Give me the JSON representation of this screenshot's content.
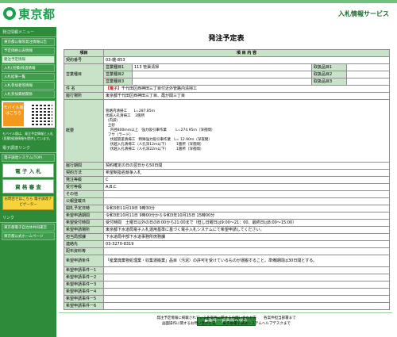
{
  "header": {
    "logo_text": "東京都",
    "service_title": "入札情報サービス"
  },
  "sidebar": {
    "menu_heading": "発注情報メニュー",
    "links": [
      "東京都公報等発注情報公告",
      "予定価格公表情報",
      "発注予定情報",
      "入札(見積)経過情報",
      "入札結果一覧",
      "入札参加者等情報",
      "入札参加資格関係"
    ],
    "mobile_button": "モバイル版はこちら",
    "mobile_note": "モバイル版は、発注予定情報と入札(見積)経過情報を提供しています。",
    "links_heading": "電子調達リンク",
    "system_link": "電子調達システム(TOP)",
    "big_buttons": [
      "電 子 入 札",
      "資 格 審 査"
    ],
    "ad_text": "お問合せはこちら 電子調達ナビゲーター",
    "other_heading": "リンク",
    "other_links": [
      "東京都電子自治体共同運営",
      "東京都公式ホームページ"
    ]
  },
  "main": {
    "title": "発注予定表",
    "header_row": {
      "left": "項目",
      "right": "項 目 内 容"
    },
    "rows": [
      {
        "label": "契約番号",
        "value": "03-雑-853"
      },
      {
        "label": "件 名",
        "tag": "【電子】",
        "value": "千代田区西神田三丁目付近外管路内清掃工"
      },
      {
        "label": "履行場所",
        "value": "東京都千代田区西神田三丁目、霞が関三丁目"
      }
    ],
    "business_type": {
      "label": "営業種目",
      "items": [
        {
          "name": "営業種目1",
          "value": "113 管渠清掃",
          "rank_label": "取扱品目1",
          "rank_value": ""
        },
        {
          "name": "営業種目2",
          "value": "",
          "rank_label": "取扱品目2",
          "rank_value": ""
        },
        {
          "name": "営業種目3",
          "value": "",
          "rank_label": "取扱品目3",
          "rank_value": ""
        }
      ]
    },
    "overview": {
      "label": "概要",
      "lines": [
        "管路内清掃工      L=287.85ｍ",
        "伏越入孔清掃工    2箇所",
        "（内訳）",
        "  土砂",
        "    内径800mm以上   強力吸引車作業        L=274.95ｍ（深夜間）",
        "  フサ（ラード）",
        "    伏越管渠清掃工   特殊強力吸引車作業   L= 12.90ｍ（深夜間）",
        "    伏越入孔清掃工（人孔深12ｍ以下）       1箇所（深夜間）",
        "    伏越入孔清掃工（人孔深22ｍ以下）       1箇所（深夜間）"
      ]
    },
    "rows2": [
      {
        "label": "履行期間",
        "value": "契約確定の日の翌日から50日間"
      },
      {
        "label": "契約方法",
        "value": "希望制指名競争入札"
      },
      {
        "label": "発注等級",
        "value": "C"
      },
      {
        "label": "受付等級",
        "value": "A,B,C"
      },
      {
        "label": "その他",
        "value": ""
      },
      {
        "label": "公報登載日",
        "value": ""
      },
      {
        "label": "開札予定日時",
        "value": "令和3年11月19日 9時30分"
      },
      {
        "label": "希望申請期間",
        "value": "令和3年10月11日 9時00分から令和3年10月15日 15時00分"
      },
      {
        "label": "希望受付時間",
        "value": "受付時間　土曜日以外の日の8:00から21:00まで（但し日曜日は9:00～21：00、最終日は8:00～15:00）"
      },
      {
        "label": "希望申請場所",
        "value": "東京都下水道局電子入札運用基準に基づく電子入札システムにて希望申請してください。"
      },
      {
        "label": "担当局部課",
        "value": "下水道局中部下水道事務所庶務課"
      },
      {
        "label": "連絡先",
        "value": "03-3270-8319"
      },
      {
        "label": "配布資料等",
        "value": ""
      },
      {
        "label": "希望申請条件",
        "value": "「産業廃棄物処理業・収集運搬業」品目（汚泥）の許可を受けているものが運搬すること。準備期間は30日間とする。"
      },
      {
        "label": "希望申請事件ー1",
        "value": ""
      },
      {
        "label": "希望申請事件ー2",
        "value": ""
      },
      {
        "label": "希望申請事件ー3",
        "value": ""
      },
      {
        "label": "希望申請事件ー4",
        "value": ""
      },
      {
        "label": "希望申請事件ー5",
        "value": ""
      },
      {
        "label": "希望申請事件ー6",
        "value": ""
      }
    ],
    "list_button": "▶案件一覧画面へ戻る"
  },
  "footer": {
    "line1": "発注予定情報に掲載されている各案件に関するお問い合わせ先　　各案件担当部署まで",
    "line2": "画面操作に関するお問い合わせ先　　東京都電子調達システムヘルプデスクまで"
  }
}
